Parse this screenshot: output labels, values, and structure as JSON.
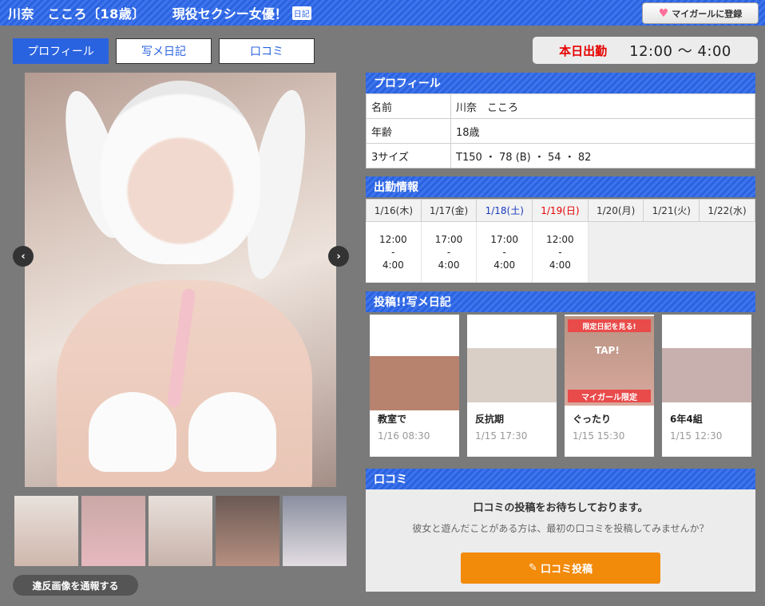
{
  "header": {
    "title": "川奈　こころ〔18歳〕",
    "catch": "現役セクシー女優！",
    "diary_badge": "日記",
    "mygirl_label": "マイガールに登録",
    "mygirl_icon": "heart-icon"
  },
  "tabs": [
    {
      "label": "プロフィール",
      "active": true
    },
    {
      "label": "写メ日記",
      "active": false
    },
    {
      "label": "口コミ",
      "active": false
    }
  ],
  "today": {
    "label": "本日出勤",
    "time": "12:00 ～ 4:00"
  },
  "report_label": "違反画像を通報する",
  "profile": {
    "heading": "プロフィール",
    "rows": [
      {
        "key": "名前",
        "value": "川奈　こころ"
      },
      {
        "key": "年齢",
        "value": "18歳"
      },
      {
        "key": "3サイズ",
        "value": "T150 ・ 78 (B) ・ 54 ・ 82"
      }
    ]
  },
  "schedule": {
    "heading": "出勤情報",
    "days": [
      {
        "label": "1/16(木)",
        "kind": "weekday",
        "start": "12:00",
        "sep": "-",
        "end": "4:00"
      },
      {
        "label": "1/17(金)",
        "kind": "weekday",
        "start": "17:00",
        "sep": "-",
        "end": "4:00"
      },
      {
        "label": "1/18(土)",
        "kind": "sat",
        "start": "17:00",
        "sep": "-",
        "end": "4:00"
      },
      {
        "label": "1/19(日)",
        "kind": "sun",
        "start": "12:00",
        "sep": "-",
        "end": "4:00"
      },
      {
        "label": "1/20(月)",
        "kind": "weekday"
      },
      {
        "label": "1/21(火)",
        "kind": "weekday"
      },
      {
        "label": "1/22(水)",
        "kind": "weekday"
      }
    ]
  },
  "diary": {
    "heading": "投稿!!写メ日記",
    "limited_top": "限定日記を見る!",
    "limited_tap": "TAP!",
    "limited_bottom": "マイガール限定",
    "posts": [
      {
        "title": "教室で",
        "date": "1/16 08:30",
        "color": "#b7836e"
      },
      {
        "title": "反抗期",
        "date": "1/15 17:30",
        "color": "#d9cfc6"
      },
      {
        "title": "ぐったり",
        "date": "1/15 15:30",
        "color": "#c99b8d"
      },
      {
        "title": "6年4組",
        "date": "1/15 12:30",
        "color": "#c8b0ae"
      }
    ]
  },
  "review": {
    "heading": "口コミ",
    "message": "口コミの投稿をお待ちしております。",
    "sub": "彼女と遊んだことがある方は、最初の口コミを投稿してみませんか？",
    "button": "口コミ投稿",
    "button_icon": "pen-icon"
  },
  "colors": {
    "brand_blue": "#2a63e0",
    "accent_red": "#e60000",
    "button_orange": "#f28a0a"
  }
}
